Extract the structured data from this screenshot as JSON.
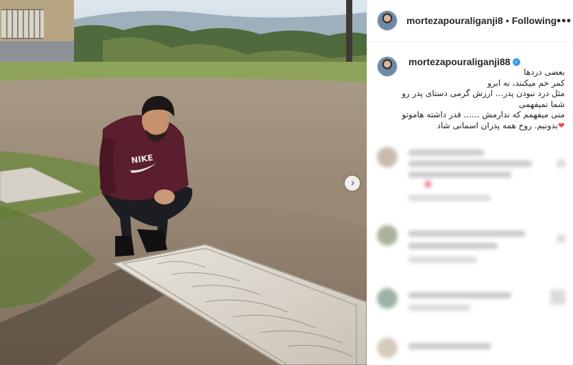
{
  "post": {
    "username": "mortezapouraliganji8",
    "header_separator": "•",
    "follow_state": "Following",
    "more_glyph": "•••",
    "caption_username": "mortezapouraliganji88",
    "verified_glyph": "✓",
    "caption_lines": [
      "بعضی دردها",
      "کمر خم میکنند، نه ابرو",
      "مثل درد نبودن پدر... ارزش گرمی دستای پدر رو",
      "شما نمیفهمی",
      "منی میفهمم که ندارمش ...... قدر داشته هاموتو",
      "بدونیم. روح همه پدران اسمانی شاد"
    ],
    "caption_heart": "❤",
    "carousel_next_glyph": "›"
  },
  "colors": {
    "accent": "#3897f0",
    "heart": "#ed4956",
    "hoodie": "#5a1e2c"
  }
}
